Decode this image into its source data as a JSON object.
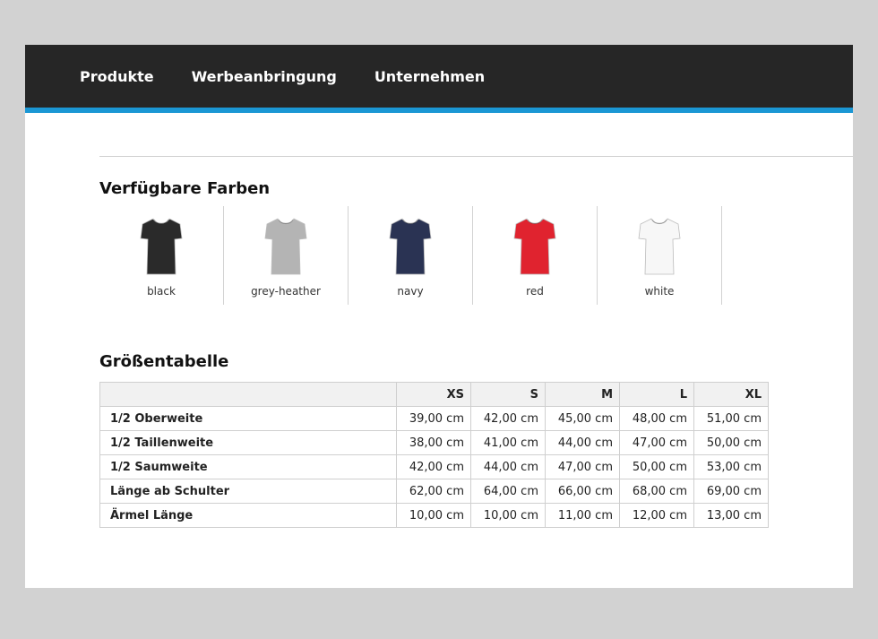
{
  "nav": {
    "items": [
      {
        "label": "Produkte"
      },
      {
        "label": "Werbeanbringung"
      },
      {
        "label": "Unternehmen"
      }
    ]
  },
  "colors_section": {
    "title": "Verfügbare Farben",
    "swatches": [
      {
        "label": "black",
        "color": "#2a2a2a"
      },
      {
        "label": "grey-heather",
        "color": "#b4b4b4"
      },
      {
        "label": "navy",
        "color": "#2a3353"
      },
      {
        "label": "red",
        "color": "#e0232f"
      },
      {
        "label": "white",
        "color": "#f7f7f7"
      }
    ]
  },
  "size_table": {
    "title": "Größentabelle",
    "columns": [
      "",
      "XS",
      "S",
      "M",
      "L",
      "XL"
    ],
    "rows": [
      {
        "label": "1/2 Oberweite",
        "values": [
          "39,00 cm",
          "42,00 cm",
          "45,00 cm",
          "48,00 cm",
          "51,00 cm"
        ]
      },
      {
        "label": "1/2 Taillenweite",
        "values": [
          "38,00 cm",
          "41,00 cm",
          "44,00 cm",
          "47,00 cm",
          "50,00 cm"
        ]
      },
      {
        "label": "1/2 Saumweite",
        "values": [
          "42,00 cm",
          "44,00 cm",
          "47,00 cm",
          "50,00 cm",
          "53,00 cm"
        ]
      },
      {
        "label": "Länge ab Schulter",
        "values": [
          "62,00 cm",
          "64,00 cm",
          "66,00 cm",
          "68,00 cm",
          "69,00 cm"
        ]
      },
      {
        "label": "Ärmel Länge",
        "values": [
          "10,00 cm",
          "10,00 cm",
          "11,00 cm",
          "12,00 cm",
          "13,00 cm"
        ]
      }
    ]
  },
  "theme": {
    "nav_bg": "#262626",
    "accent": "#1b97d4",
    "page_bg": "#d2d2d2"
  }
}
